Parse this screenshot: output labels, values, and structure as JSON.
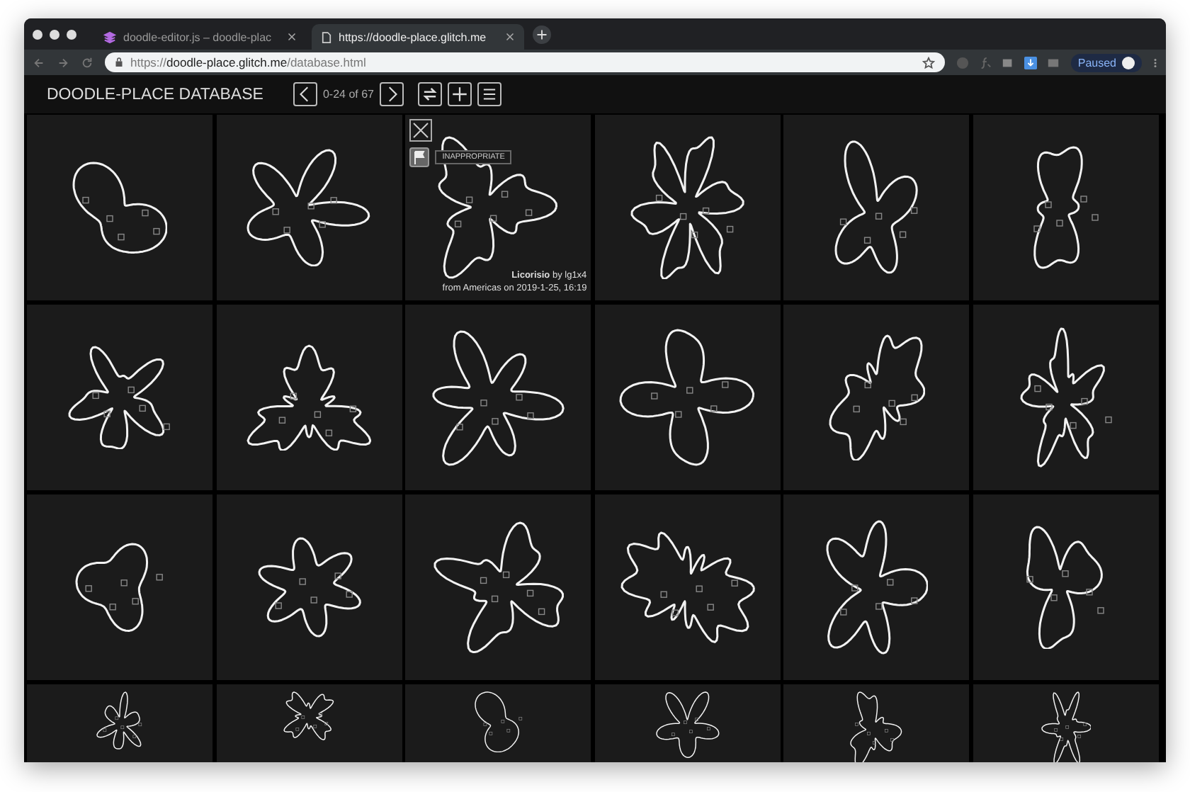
{
  "browser": {
    "tabs": [
      {
        "title": "doodle-editor.js – doodle-plac",
        "selected": false
      },
      {
        "title": "https://doodle-place.glitch.me",
        "selected": true
      }
    ],
    "address": "https://**doodle-place.glitch.me**/database.html",
    "profile": "Paused"
  },
  "header": {
    "title": "DOODLE-PLACE DATABASE",
    "range": "0-24 of 67"
  },
  "selected_doodle": {
    "flag_label": "INAPPROPRIATE",
    "credit": "**Licorisio** by lg1x4",
    "origin": "from Americas on 2019-1-25, 16:19"
  }
}
